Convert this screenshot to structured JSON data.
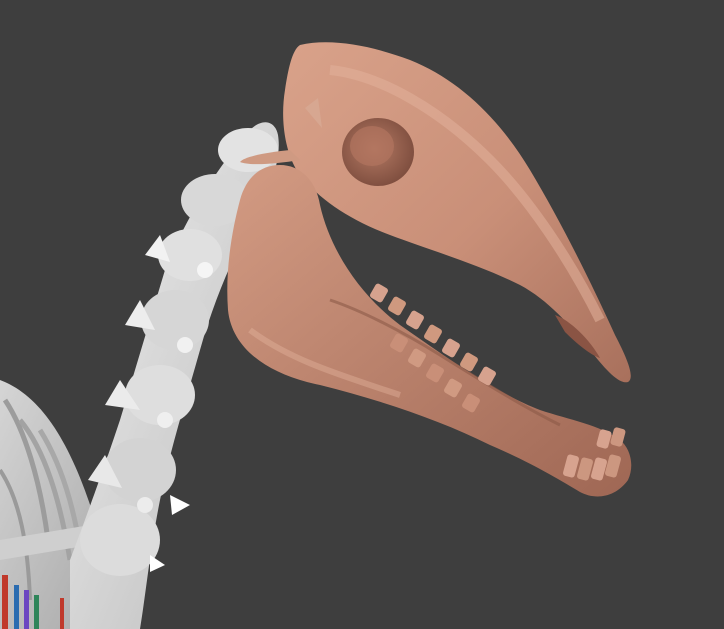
{
  "viewport": {
    "background_color": "#3e3e3e",
    "model": {
      "skull_color": "#c98f78",
      "bone_color": "#d9d9d9",
      "tooth_color": "#d6a28e",
      "rib_accent_colors": [
        "#c0392b",
        "#2b6cb0",
        "#6b46c1",
        "#2f855a"
      ]
    }
  }
}
